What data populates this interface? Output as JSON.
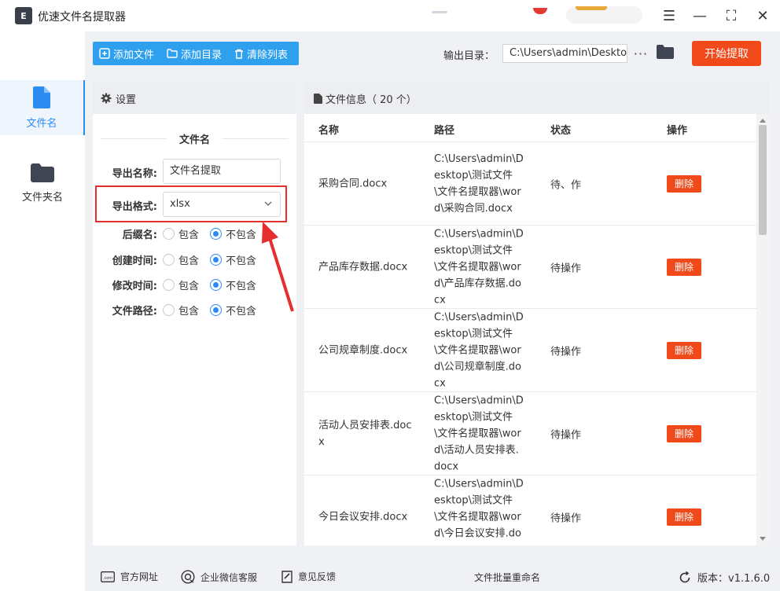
{
  "app": {
    "title": "优速文件名提取器",
    "logo_text": "E"
  },
  "window_controls": {
    "menu": "☰",
    "minimize": "—",
    "maximize": "⛶",
    "close": "✕"
  },
  "nav": [
    {
      "label": "文件名",
      "icon": "file-icon",
      "active": true
    },
    {
      "label": "文件夹名",
      "icon": "folder-icon",
      "active": false
    }
  ],
  "toolbar": {
    "add_file": "添加文件",
    "add_dir": "添加目录",
    "clear_list": "清除列表",
    "output_label": "输出目录：",
    "output_path": "C:\\Users\\admin\\Desktop",
    "more": "···",
    "start": "开始提取"
  },
  "settings": {
    "header": "设置",
    "section": "文件名",
    "export_name_label": "导出名称:",
    "export_name_value": "文件名提取",
    "export_format_label": "导出格式:",
    "export_format_value": "xlsx",
    "options": [
      {
        "label": "后缀名:",
        "include": "包含",
        "exclude": "不包含",
        "selected": "exclude"
      },
      {
        "label": "创建时间:",
        "include": "包含",
        "exclude": "不包含",
        "selected": "exclude"
      },
      {
        "label": "修改时间:",
        "include": "包含",
        "exclude": "不包含",
        "selected": "exclude"
      },
      {
        "label": "文件路径:",
        "include": "包含",
        "exclude": "不包含",
        "selected": "exclude"
      }
    ]
  },
  "files": {
    "header": "文件信息（ 20 个）",
    "columns": {
      "name": "名称",
      "path": "路径",
      "status": "状态",
      "action": "操作"
    },
    "rows": [
      {
        "name": "采购合同.docx",
        "path": "C:\\Users\\admin\\Desktop\\测试文件\\文件名提取器\\word\\采购合同.docx",
        "status": "待、作",
        "action": "删除"
      },
      {
        "name": "产品库存数据.docx",
        "path": "C:\\Users\\admin\\Desktop\\测试文件\\文件名提取器\\word\\产品库存数据.docx",
        "status": "待操作",
        "action": "删除"
      },
      {
        "name": "公司规章制度.docx",
        "path": "C:\\Users\\admin\\Desktop\\测试文件\\文件名提取器\\word\\公司规章制度.docx",
        "status": "待操作",
        "action": "删除"
      },
      {
        "name": "活动人员安排表.docx",
        "path": "C:\\Users\\admin\\Desktop\\测试文件\\文件名提取器\\word\\活动人员安排表.docx",
        "status": "待操作",
        "action": "删除"
      },
      {
        "name": "今日会议安排.docx",
        "path": "C:\\Users\\admin\\Desktop\\测试文件\\文件名提取器\\word\\今日会议安排.docx",
        "status": "待操作",
        "action": "删除"
      }
    ]
  },
  "footer": {
    "website": "官方网址",
    "wechat": "企业微信客服",
    "feedback": "意见反馈",
    "center": "文件批量重命名",
    "version": "版本：v1.1.6.0"
  },
  "colors": {
    "accent": "#2c8cf4",
    "toolbar_blue": "#2fa0ee",
    "danger": "#f04a1b",
    "highlight": "#e52e2e"
  }
}
